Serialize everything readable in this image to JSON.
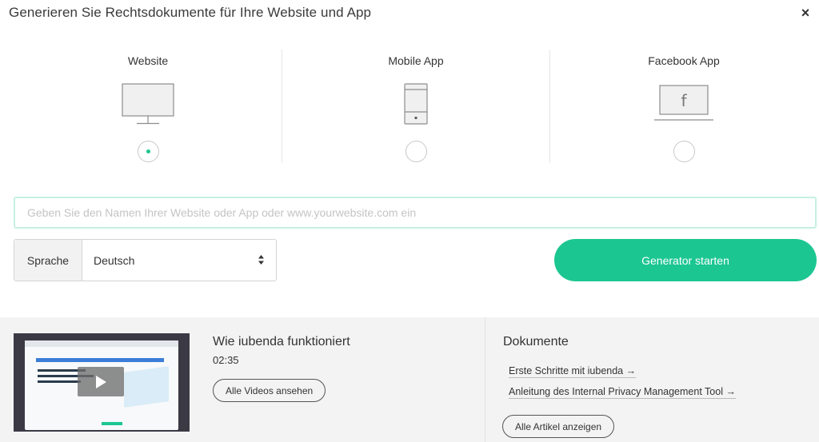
{
  "header": {
    "title": "Generieren Sie Rechtsdokumente für Ihre Website und App",
    "close_icon": "close-icon",
    "close_glyph": "×"
  },
  "platforms": [
    {
      "label": "Website",
      "icon": "monitor-icon",
      "selected": true
    },
    {
      "label": "Mobile App",
      "icon": "smartphone-icon",
      "selected": false
    },
    {
      "label": "Facebook App",
      "icon": "facebook-app-icon",
      "icon_text": "f",
      "selected": false
    }
  ],
  "name_input": {
    "value": "",
    "placeholder": "Geben Sie den Namen Ihrer Website oder App oder www.yourwebsite.com ein"
  },
  "language": {
    "label": "Sprache",
    "selected": "Deutsch"
  },
  "start_button": {
    "label": "Generator starten"
  },
  "video": {
    "title": "Wie iubenda funktioniert",
    "duration": "02:35",
    "all_videos_label": "Alle Videos ansehen",
    "thumbnail_icon": "play-icon"
  },
  "documents": {
    "title": "Dokumente",
    "links": [
      {
        "label": "Erste Schritte mit iubenda →"
      },
      {
        "label": "Anleitung des Internal Privacy Management Tool →"
      }
    ],
    "all_articles_label": "Alle Artikel anzeigen"
  },
  "colors": {
    "accent": "#1cc691",
    "input_border": "#c6f0e2",
    "bottom_bg": "#f3f3f3"
  }
}
